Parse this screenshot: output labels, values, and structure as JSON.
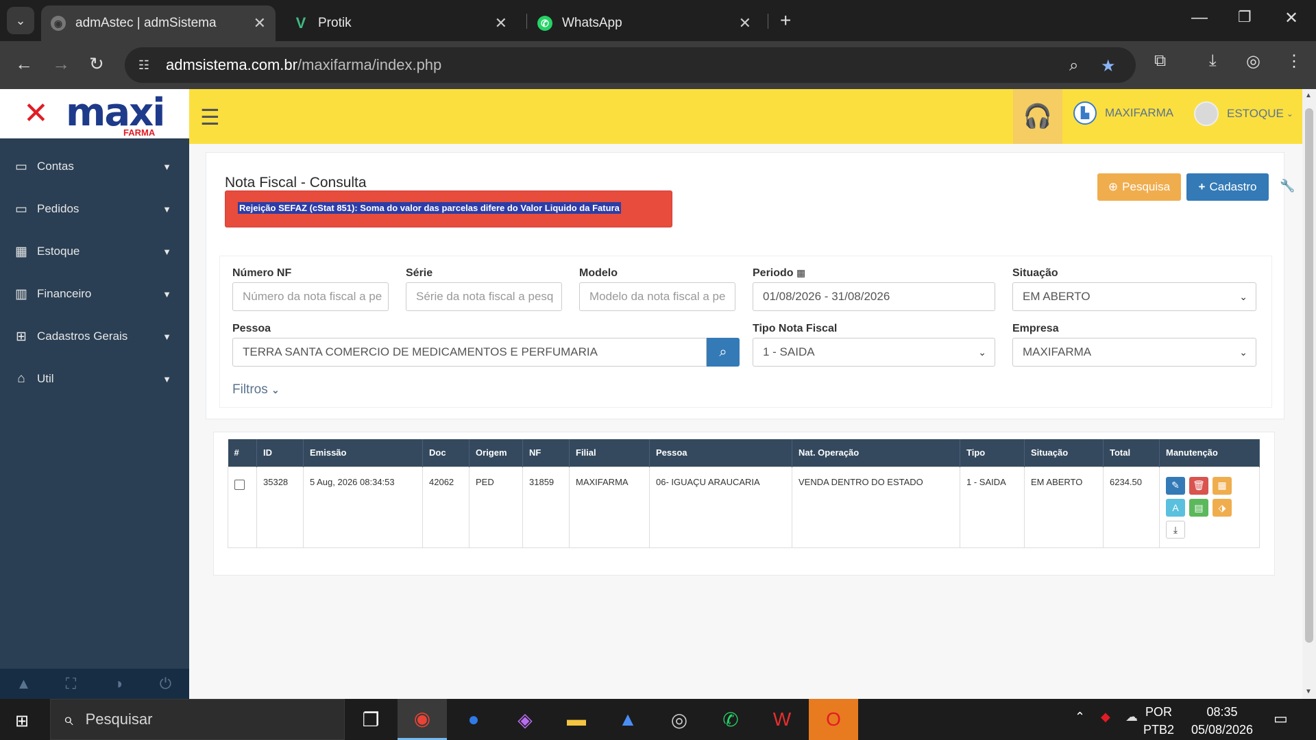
{
  "browser": {
    "tabs": [
      {
        "title": "admAstec | admSistema",
        "active": true
      },
      {
        "title": "Protik",
        "active": false
      },
      {
        "title": "WhatsApp",
        "active": false
      }
    ],
    "url_host": "admsistema.com.br",
    "url_path": "/maxifarma/index.php"
  },
  "logo": {
    "text": "maxi",
    "sub": "FARMA"
  },
  "sidebar": {
    "items": [
      {
        "label": "Contas",
        "icon": "monitor-icon"
      },
      {
        "label": "Pedidos",
        "icon": "monitor-icon"
      },
      {
        "label": "Estoque",
        "icon": "table-icon"
      },
      {
        "label": "Financeiro",
        "icon": "bar-chart-icon"
      },
      {
        "label": "Cadastros Gerais",
        "icon": "sitemap-icon"
      },
      {
        "label": "Util",
        "icon": "home-icon"
      }
    ]
  },
  "topnav": {
    "company": "MAXIFARMA",
    "user": "ESTOQUE"
  },
  "page": {
    "title": "Nota Fiscal - Consulta",
    "alert": "Rejeição SEFAZ (cStat 851): Soma do valor das parcelas difere do Valor Liquido da Fatura",
    "btn_search": "Pesquisa",
    "btn_create": "Cadastro"
  },
  "filters": {
    "numero_label": "Número NF",
    "numero_placeholder": "Número da nota fiscal a pe",
    "serie_label": "Série",
    "serie_placeholder": "Série da nota fiscal a pesq",
    "modelo_label": "Modelo",
    "modelo_placeholder": "Modelo da nota fiscal a pe",
    "periodo_label": "Periodo",
    "periodo_value": "01/08/2026 - 31/08/2026",
    "situacao_label": "Situação",
    "situacao_value": "EM ABERTO",
    "pessoa_label": "Pessoa",
    "pessoa_value": "TERRA SANTA COMERCIO DE MEDICAMENTOS E PERFUMARIA",
    "tipo_label": "Tipo Nota Fiscal",
    "tipo_value": "1 - SAIDA",
    "empresa_label": "Empresa",
    "empresa_value": "MAXIFARMA",
    "filtros": "Filtros"
  },
  "table": {
    "headers": [
      "#",
      "ID",
      "Emissão",
      "Doc",
      "Origem",
      "NF",
      "Filial",
      "Pessoa",
      "Nat. Operação",
      "Tipo",
      "Situação",
      "Total",
      "Manutenção"
    ],
    "rows": [
      {
        "id": "35328",
        "emissao": "5 Aug, 2026 08:34:53",
        "doc": "42062",
        "origem": "PED",
        "nf": "31859",
        "filial": "MAXIFARMA",
        "pessoa": "06- IGUAÇU ARAUCARIA",
        "natop": "VENDA DENTRO DO ESTADO",
        "tipo": "1 - SAIDA",
        "situacao": "EM ABERTO",
        "total": "6234.50"
      }
    ]
  },
  "taskbar": {
    "search": "Pesquisar",
    "lang1": "POR",
    "lang2": "PTB2",
    "time": "08:35",
    "date": "05/08/2026"
  }
}
